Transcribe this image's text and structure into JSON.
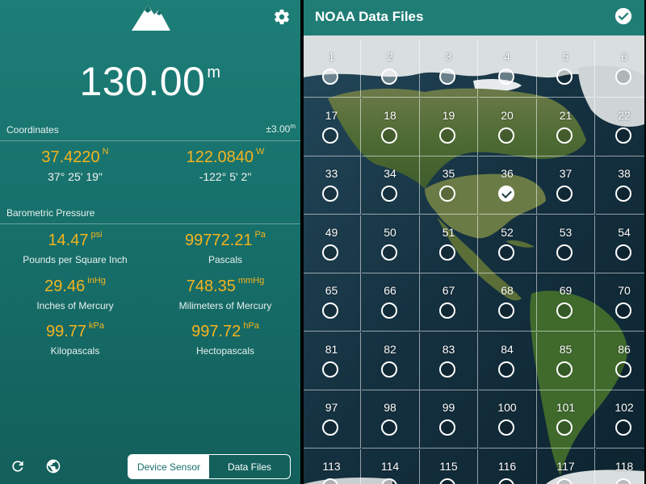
{
  "left": {
    "altitude": {
      "value": "130.00",
      "unit": "m"
    },
    "coordinates": {
      "header": "Coordinates",
      "accuracy": {
        "value": "±3.00",
        "unit": "m"
      },
      "latitude": {
        "value": "37.4220",
        "dir": "N",
        "dms": "37° 25' 19\""
      },
      "longitude": {
        "value": "122.0840",
        "dir": "W",
        "dms": "-122° 5' 2\""
      }
    },
    "pressure": {
      "header": "Barometric Pressure",
      "psi": {
        "value": "14.47",
        "unit": "psi",
        "label": "Pounds per Square Inch"
      },
      "pa": {
        "value": "99772.21",
        "unit": "Pa",
        "label": "Pascals"
      },
      "inhg": {
        "value": "29.46",
        "unit": "inHg",
        "label": "Inches of Mercury"
      },
      "mmhg": {
        "value": "748.35",
        "unit": "mmHg",
        "label": "Milimeters of Mercury"
      },
      "kpa": {
        "value": "99.77",
        "unit": "kPa",
        "label": "Kilopascals"
      },
      "hpa": {
        "value": "997.72",
        "unit": "hPa",
        "label": "Hectopascals"
      }
    },
    "bottom": {
      "refresh_icon": "refresh-icon",
      "globe_icon": "globe-icon",
      "tabs": [
        {
          "label": "Device Sensor",
          "active": true
        },
        {
          "label": "Data Files",
          "active": false
        }
      ]
    },
    "icons": {
      "logo": "mountain-logo",
      "settings": "gear-icon"
    }
  },
  "right": {
    "title": "NOAA Data Files",
    "done_icon": "check-circle-icon",
    "tiles": [
      [
        "1",
        "2",
        "3",
        "4",
        "5",
        "6"
      ],
      [
        "17",
        "18",
        "19",
        "20",
        "21",
        "22"
      ],
      [
        "33",
        "34",
        "35",
        "36",
        "37",
        "38"
      ],
      [
        "49",
        "50",
        "51",
        "52",
        "53",
        "54"
      ],
      [
        "65",
        "66",
        "67",
        "68",
        "69",
        "70"
      ],
      [
        "81",
        "82",
        "83",
        "84",
        "85",
        "86"
      ],
      [
        "97",
        "98",
        "99",
        "100",
        "101",
        "102"
      ],
      [
        "113",
        "114",
        "115",
        "116",
        "117",
        "118"
      ]
    ],
    "selected_tiles": [
      "1",
      "2",
      "3",
      "4",
      "36"
    ]
  },
  "colors": {
    "primary": "#17706b",
    "header": "#1f7d76",
    "accent_orange": "#f5b41e"
  }
}
